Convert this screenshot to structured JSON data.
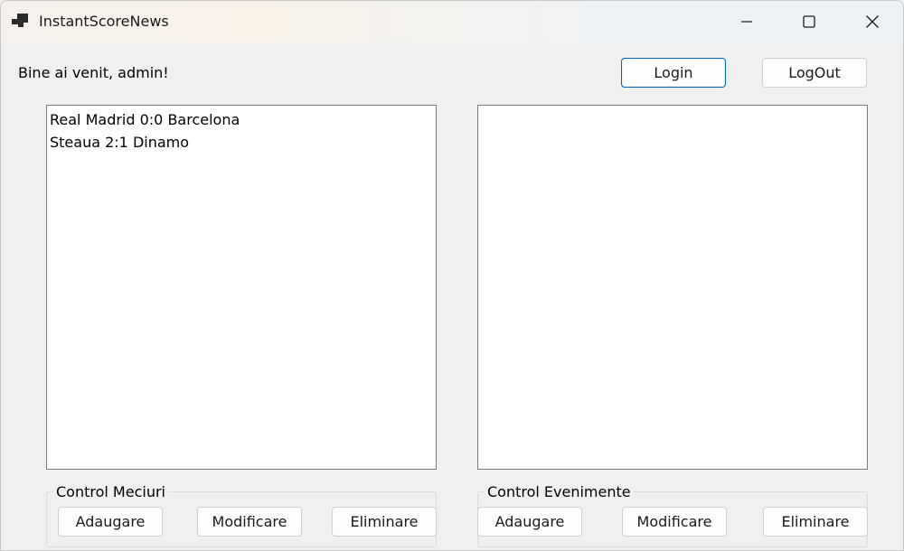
{
  "window": {
    "title": "InstantScoreNews",
    "minimize_icon": "minimize-icon",
    "maximize_icon": "maximize-icon",
    "close_icon": "close-icon"
  },
  "header": {
    "welcome_text": "Bine ai venit, admin!",
    "login_label": "Login",
    "logout_label": "LogOut"
  },
  "matches_list": {
    "items": [
      "Real Madrid 0:0 Barcelona",
      "Steaua 2:1 Dinamo"
    ]
  },
  "events_list": {
    "items": []
  },
  "match_controls": {
    "group_label": "Control Meciuri",
    "add_label": "Adaugare",
    "edit_label": "Modificare",
    "delete_label": "Eliminare"
  },
  "event_controls": {
    "group_label": "Control Evenimente",
    "add_label": "Adaugare",
    "edit_label": "Modificare",
    "delete_label": "Eliminare"
  },
  "colors": {
    "accent": "#0067c0",
    "window_bg": "#f0f0f0"
  }
}
